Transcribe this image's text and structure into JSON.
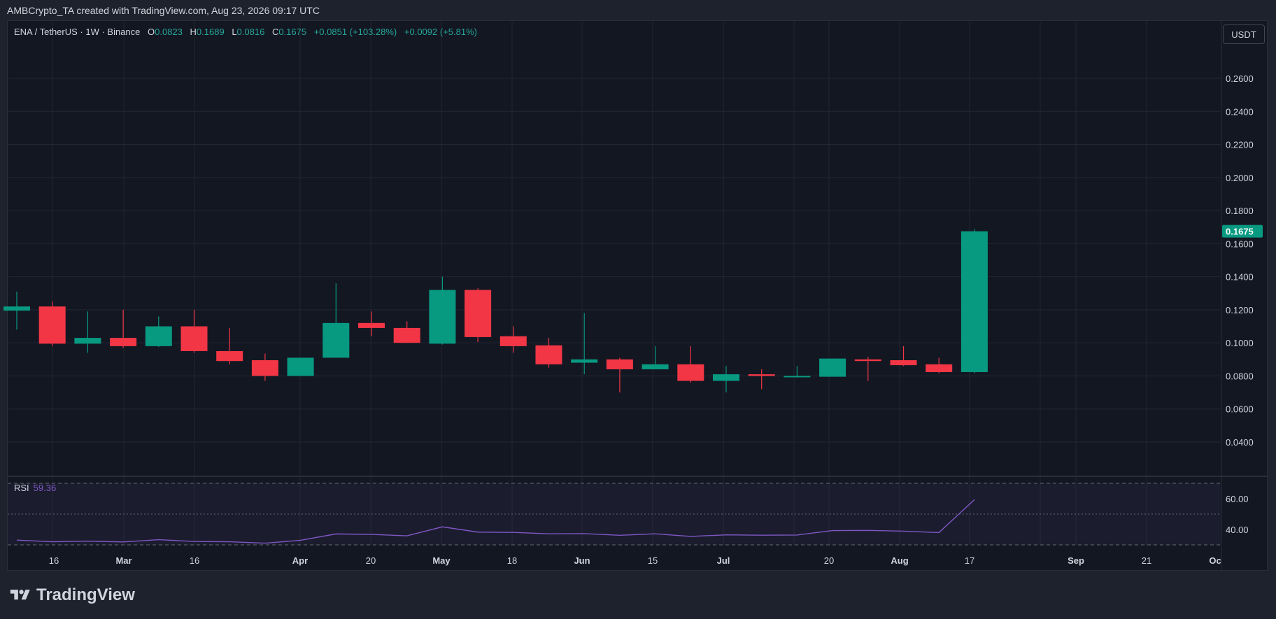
{
  "header": {
    "attribution": "AMBCrypto_TA created with TradingView.com, Aug 23, 2026 09:17 UTC"
  },
  "legend": {
    "symbol": "ENA / TetherUS · 1W · Binance",
    "o_label": "O",
    "o_value": "0.0823",
    "h_label": "H",
    "h_value": "0.1689",
    "l_label": "L",
    "l_value": "0.0816",
    "c_label": "C",
    "c_value": "0.1675",
    "change": "+0.0851 (+103.28%)",
    "change2": "+0.0092 (+5.81%)"
  },
  "currency_button": "USDT",
  "rsi": {
    "name": "RSI",
    "value": "59.36"
  },
  "brand": {
    "name": "TradingView"
  },
  "colors": {
    "up": "#089981",
    "down": "#f23645",
    "rsi_line": "#7e57c2",
    "background": "#131722",
    "grid": "#2a2e39",
    "text": "#d1d4dc"
  },
  "chart_data": [
    {
      "type": "candlestick",
      "title": "ENA / TetherUS · 1W · Binance",
      "ylim": [
        0.02,
        0.28
      ],
      "y_ticks": [
        "0.0400",
        "0.0600",
        "0.0800",
        "0.1000",
        "0.1200",
        "0.1400",
        "0.1600",
        "0.1800",
        "0.2000",
        "0.2200",
        "0.2400",
        "0.2600"
      ],
      "x_ticks": [
        "16",
        "Mar",
        "16",
        "Apr",
        "20",
        "May",
        "18",
        "Jun",
        "15",
        "Jul",
        "20",
        "Aug",
        "17",
        "Sep",
        "21",
        "Oc"
      ],
      "last_price_label": "0.1675",
      "candles": [
        {
          "o": 0.1195,
          "h": 0.131,
          "l": 0.108,
          "c": 0.122
        },
        {
          "o": 0.122,
          "h": 0.125,
          "l": 0.098,
          "c": 0.0995
        },
        {
          "o": 0.0995,
          "h": 0.119,
          "l": 0.094,
          "c": 0.103
        },
        {
          "o": 0.103,
          "h": 0.12,
          "l": 0.097,
          "c": 0.098
        },
        {
          "o": 0.098,
          "h": 0.116,
          "l": 0.0975,
          "c": 0.11
        },
        {
          "o": 0.11,
          "h": 0.12,
          "l": 0.094,
          "c": 0.095
        },
        {
          "o": 0.095,
          "h": 0.109,
          "l": 0.087,
          "c": 0.089
        },
        {
          "o": 0.0895,
          "h": 0.0935,
          "l": 0.077,
          "c": 0.08
        },
        {
          "o": 0.08,
          "h": 0.091,
          "l": 0.08,
          "c": 0.091
        },
        {
          "o": 0.091,
          "h": 0.136,
          "l": 0.091,
          "c": 0.112
        },
        {
          "o": 0.112,
          "h": 0.119,
          "l": 0.104,
          "c": 0.109
        },
        {
          "o": 0.109,
          "h": 0.113,
          "l": 0.1,
          "c": 0.1
        },
        {
          "o": 0.0995,
          "h": 0.14,
          "l": 0.099,
          "c": 0.132
        },
        {
          "o": 0.132,
          "h": 0.133,
          "l": 0.1005,
          "c": 0.1035
        },
        {
          "o": 0.104,
          "h": 0.11,
          "l": 0.094,
          "c": 0.098
        },
        {
          "o": 0.0985,
          "h": 0.103,
          "l": 0.085,
          "c": 0.087
        },
        {
          "o": 0.088,
          "h": 0.118,
          "l": 0.081,
          "c": 0.09
        },
        {
          "o": 0.09,
          "h": 0.091,
          "l": 0.07,
          "c": 0.084
        },
        {
          "o": 0.084,
          "h": 0.098,
          "l": 0.084,
          "c": 0.087
        },
        {
          "o": 0.087,
          "h": 0.098,
          "l": 0.076,
          "c": 0.077
        },
        {
          "o": 0.077,
          "h": 0.086,
          "l": 0.07,
          "c": 0.081
        },
        {
          "o": 0.081,
          "h": 0.084,
          "l": 0.072,
          "c": 0.08
        },
        {
          "o": 0.0795,
          "h": 0.086,
          "l": 0.079,
          "c": 0.08
        },
        {
          "o": 0.0795,
          "h": 0.0905,
          "l": 0.0795,
          "c": 0.0905
        },
        {
          "o": 0.09,
          "h": 0.0915,
          "l": 0.077,
          "c": 0.089
        },
        {
          "o": 0.0895,
          "h": 0.098,
          "l": 0.086,
          "c": 0.0865
        },
        {
          "o": 0.087,
          "h": 0.091,
          "l": 0.0815,
          "c": 0.0823
        },
        {
          "o": 0.0823,
          "h": 0.1689,
          "l": 0.0816,
          "c": 0.1675
        }
      ]
    },
    {
      "type": "line",
      "title": "RSI",
      "ylim": [
        30,
        70
      ],
      "y_ticks": [
        "40.00",
        "60.00"
      ],
      "bands": [
        30,
        50,
        70
      ],
      "series": [
        {
          "name": "RSI",
          "values": [
            33.1,
            32.0,
            32.4,
            31.9,
            33.4,
            32.2,
            32.0,
            31.1,
            33.0,
            37.1,
            36.8,
            35.9,
            41.7,
            38.3,
            38.1,
            37.2,
            37.3,
            36.2,
            37.2,
            35.5,
            36.5,
            36.3,
            36.4,
            39.3,
            39.4,
            38.9,
            38.0,
            59.36
          ]
        }
      ]
    }
  ]
}
